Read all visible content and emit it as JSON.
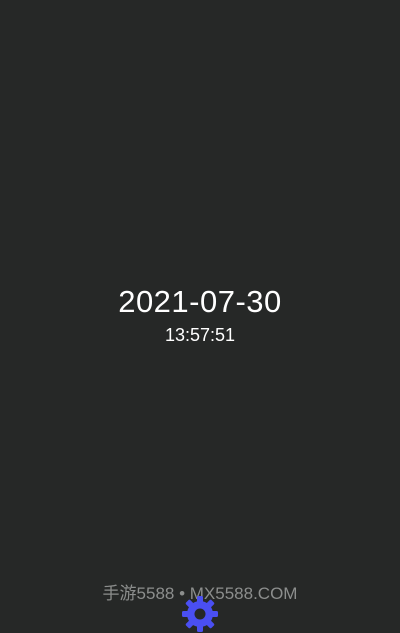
{
  "clock": {
    "date": "2021-07-30",
    "time": "13:57:51"
  },
  "watermark": {
    "text": "手游5588 • MX5588.COM"
  },
  "settings_button": {
    "icon": "gear-icon",
    "color": "#4a4ff2"
  },
  "colors": {
    "background": "#262827",
    "clock_text": "#ffffff",
    "watermark_text": "#8c8e8d"
  }
}
